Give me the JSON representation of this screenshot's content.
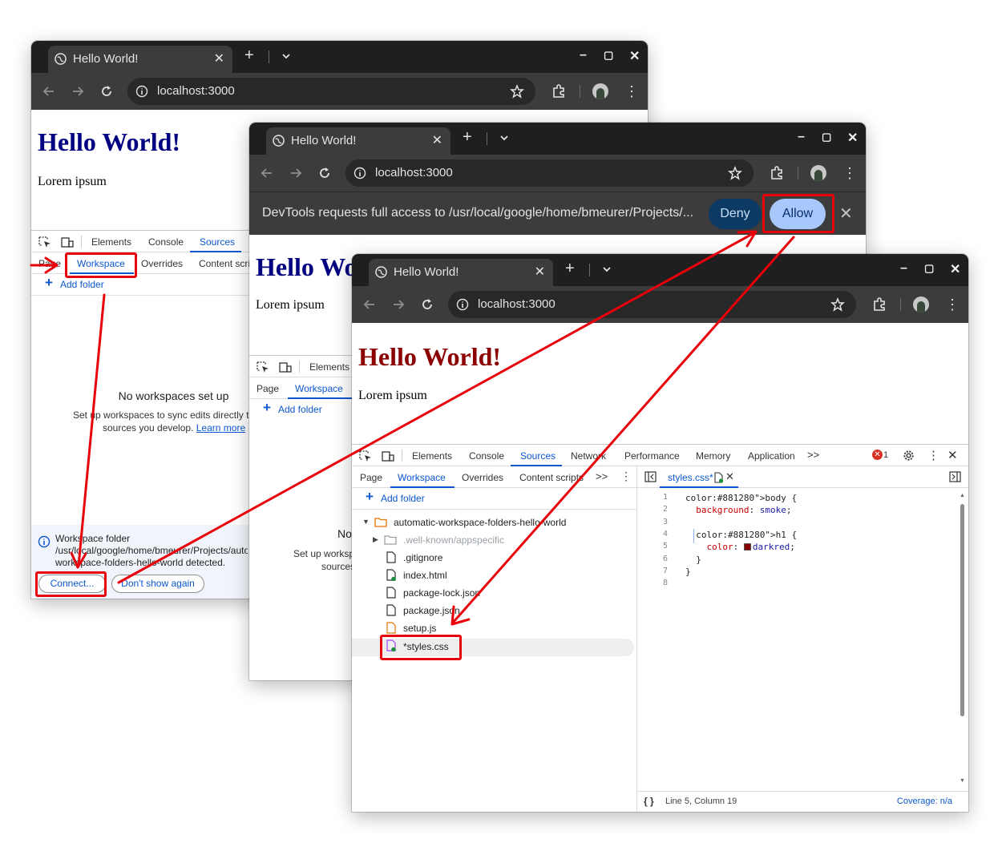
{
  "tab_title": "Hello World!",
  "new_tab": "+",
  "url": "localhost:3000",
  "page": {
    "heading": "Hello World!",
    "body": "Lorem ipsum"
  },
  "infobar": {
    "message": "DevTools requests full access to /usr/local/google/home/bmeurer/Projects/...",
    "deny": "Deny",
    "allow": "Allow"
  },
  "devtools": {
    "panels": [
      "Elements",
      "Console",
      "Sources",
      "Network",
      "Performance",
      "Memory",
      "Application"
    ],
    "panels_more": ">>",
    "error_count": "1",
    "subtabs": [
      "Page",
      "Workspace",
      "Overrides",
      "Content scripts"
    ],
    "subtabs_truncated": {
      "w1": "Content scri",
      "w3": "Content scripts"
    },
    "network_label": "Network",
    "add_folder": "Add folder",
    "no_ws_title": "No workspaces set up",
    "no_ws_desc_1": "Set up workspaces to sync edits directly to the",
    "no_ws_desc_2": "sources you develop.",
    "learn_more": "Learn more",
    "w2_no": "No",
    "w2_setup_1": "Set up worksp",
    "w2_setup_2": "sources",
    "notice": {
      "title": "Workspace folder",
      "path": "/usr/local/google/home/bmeurer/Projects/automatic-",
      "path2": "workspace-folders-hello-world detected.",
      "connect": "Connect...",
      "dont_show": "Don't show again"
    },
    "tree": {
      "root": "automatic-workspace-folders-hello-world",
      "wellknown": ".well-known/appspecific",
      "files": [
        ".gitignore",
        "index.html",
        "package-lock.json",
        "package.json",
        "setup.js",
        "*styles.css"
      ]
    },
    "editor_tab": "styles.css*",
    "code_lines": [
      "body {",
      "  background: smoke;",
      "",
      "  h1 {",
      "    color: darkred;",
      "  }",
      "}",
      ""
    ],
    "status_pos": "Line 5, Column 19",
    "coverage": "Coverage: n/a"
  },
  "colors": {
    "accent": "#0b57d0",
    "arrow": "#e8000b",
    "darkred": "#8b0000",
    "navy": "#000080"
  }
}
